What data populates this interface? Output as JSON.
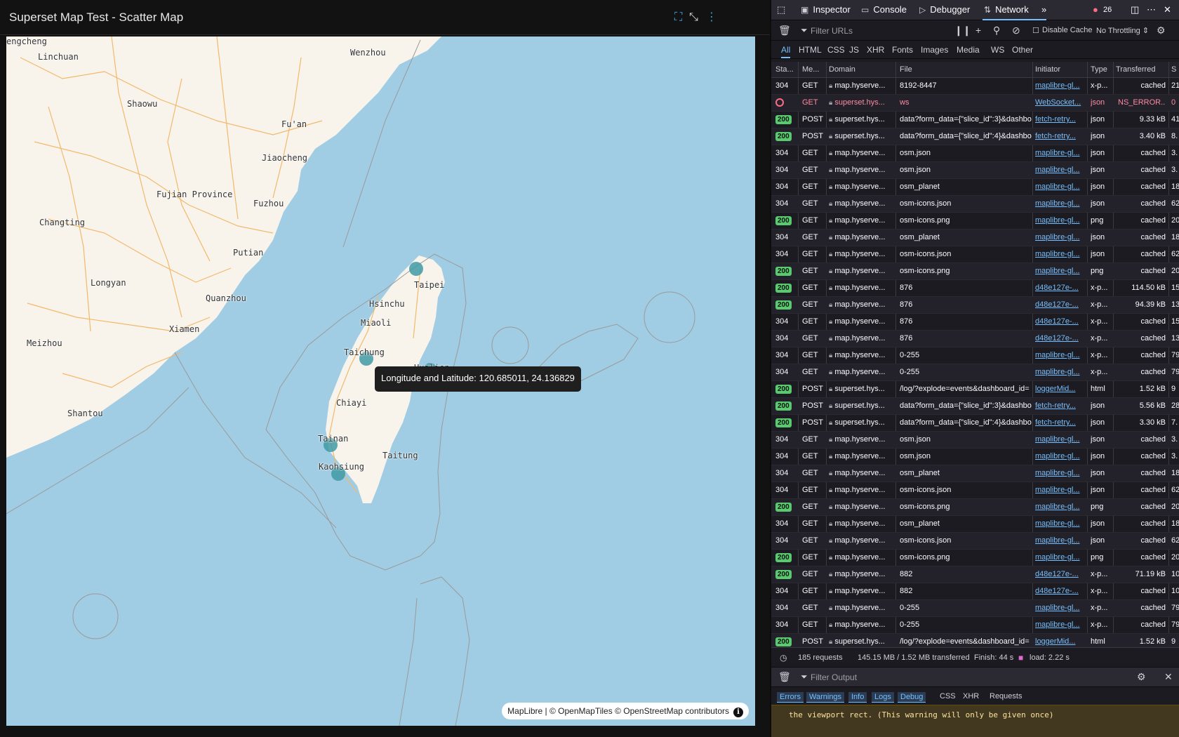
{
  "chart": {
    "title": "Superset Map Test - Scatter Map",
    "tooltip": "Longitude and Latitude: 120.685011, 24.136829",
    "attribution": "MapLibre | © OpenMapTiles © OpenStreetMap contributors",
    "info_glyph": "i",
    "cities": [
      "engcheng",
      "Linchuan",
      "Wenzhou",
      "Shaowu",
      "Fu'an",
      "Jiaocheng",
      "Fujian Province",
      "Fuzhou",
      "Changting",
      "Putian",
      "Longyan",
      "Quanzhou",
      "Xiamen",
      "Meizhou",
      "Shantou",
      "Taipei",
      "Hsinchu",
      "Miaoli",
      "Taichung",
      "Chiayi",
      "Tainan",
      "Kaohsiung",
      "Taitung",
      "Hualien"
    ]
  },
  "devtools": {
    "tabs": [
      "Inspector",
      "Console",
      "Debugger",
      "Network"
    ],
    "selected_tab": "Network",
    "error_count": "26",
    "filter_urls_placeholder": "Filter URLs",
    "disable_cache_label": "Disable Cache",
    "throttling": "No Throttling",
    "type_tabs": [
      "All",
      "HTML",
      "CSS",
      "JS",
      "XHR",
      "Fonts",
      "Images",
      "Media",
      "WS",
      "Other"
    ],
    "columns": [
      "Sta...",
      "Me...",
      "Domain",
      "File",
      "Initiator",
      "Type",
      "Transferred",
      "S"
    ],
    "rows": [
      {
        "status": "304",
        "method": "GET",
        "domain": "map.hyserve...",
        "file": "8192-8447",
        "initiator": "maplibre-gl...",
        "type": "x-p...",
        "transferred": "cached",
        "size": "21"
      },
      {
        "status": "error",
        "method": "GET",
        "domain": "superset.hys...",
        "file": "ws",
        "initiator": "WebSocket...",
        "type": "json",
        "transferred": "NS_ERROR...",
        "size": "0"
      },
      {
        "status": "200",
        "method": "POST",
        "domain": "superset.hys...",
        "file": "data?form_data={\"slice_id\":3}&dashbo",
        "initiator": "fetch-retry...",
        "type": "json",
        "transferred": "9.33 kB",
        "size": "41"
      },
      {
        "status": "200",
        "method": "POST",
        "domain": "superset.hys...",
        "file": "data?form_data={\"slice_id\":4}&dashbo",
        "initiator": "fetch-retry...",
        "type": "json",
        "transferred": "3.40 kB",
        "size": "8."
      },
      {
        "status": "304",
        "method": "GET",
        "domain": "map.hyserve...",
        "file": "osm.json",
        "initiator": "maplibre-gl...",
        "type": "json",
        "transferred": "cached",
        "size": "3."
      },
      {
        "status": "304",
        "method": "GET",
        "domain": "map.hyserve...",
        "file": "osm.json",
        "initiator": "maplibre-gl...",
        "type": "json",
        "transferred": "cached",
        "size": "3."
      },
      {
        "status": "304",
        "method": "GET",
        "domain": "map.hyserve...",
        "file": "osm_planet",
        "initiator": "maplibre-gl...",
        "type": "json",
        "transferred": "cached",
        "size": "18"
      },
      {
        "status": "304",
        "method": "GET",
        "domain": "map.hyserve...",
        "file": "osm-icons.json",
        "initiator": "maplibre-gl...",
        "type": "json",
        "transferred": "cached",
        "size": "62"
      },
      {
        "status": "200",
        "method": "GET",
        "domain": "map.hyserve...",
        "file": "osm-icons.png",
        "initiator": "maplibre-gl...",
        "type": "png",
        "transferred": "cached",
        "size": "20"
      },
      {
        "status": "304",
        "method": "GET",
        "domain": "map.hyserve...",
        "file": "osm_planet",
        "initiator": "maplibre-gl...",
        "type": "json",
        "transferred": "cached",
        "size": "18"
      },
      {
        "status": "304",
        "method": "GET",
        "domain": "map.hyserve...",
        "file": "osm-icons.json",
        "initiator": "maplibre-gl...",
        "type": "json",
        "transferred": "cached",
        "size": "62"
      },
      {
        "status": "200",
        "method": "GET",
        "domain": "map.hyserve...",
        "file": "osm-icons.png",
        "initiator": "maplibre-gl...",
        "type": "png",
        "transferred": "cached",
        "size": "20"
      },
      {
        "status": "200",
        "method": "GET",
        "domain": "map.hyserve...",
        "file": "876",
        "initiator": "d48e127e-...",
        "type": "x-p...",
        "transferred": "114.50 kB",
        "size": "15"
      },
      {
        "status": "200",
        "method": "GET",
        "domain": "map.hyserve...",
        "file": "876",
        "initiator": "d48e127e-...",
        "type": "x-p...",
        "transferred": "94.39 kB",
        "size": "13"
      },
      {
        "status": "304",
        "method": "GET",
        "domain": "map.hyserve...",
        "file": "876",
        "initiator": "d48e127e-...",
        "type": "x-p...",
        "transferred": "cached",
        "size": "15"
      },
      {
        "status": "304",
        "method": "GET",
        "domain": "map.hyserve...",
        "file": "876",
        "initiator": "d48e127e-...",
        "type": "x-p...",
        "transferred": "cached",
        "size": "13"
      },
      {
        "status": "304",
        "method": "GET",
        "domain": "map.hyserve...",
        "file": "0-255",
        "initiator": "maplibre-gl...",
        "type": "x-p...",
        "transferred": "cached",
        "size": "79"
      },
      {
        "status": "304",
        "method": "GET",
        "domain": "map.hyserve...",
        "file": "0-255",
        "initiator": "maplibre-gl...",
        "type": "x-p...",
        "transferred": "cached",
        "size": "79"
      },
      {
        "status": "200",
        "method": "POST",
        "domain": "superset.hys...",
        "file": "/log/?explode=events&dashboard_id=",
        "initiator": "loggerMid...",
        "type": "html",
        "transferred": "1.52 kB",
        "size": "9"
      },
      {
        "status": "200",
        "method": "POST",
        "domain": "superset.hys...",
        "file": "data?form_data={\"slice_id\":3}&dashbo",
        "initiator": "fetch-retry...",
        "type": "json",
        "transferred": "5.56 kB",
        "size": "28"
      },
      {
        "status": "200",
        "method": "POST",
        "domain": "superset.hys...",
        "file": "data?form_data={\"slice_id\":4}&dashbo",
        "initiator": "fetch-retry...",
        "type": "json",
        "transferred": "3.30 kB",
        "size": "7."
      },
      {
        "status": "304",
        "method": "GET",
        "domain": "map.hyserve...",
        "file": "osm.json",
        "initiator": "maplibre-gl...",
        "type": "json",
        "transferred": "cached",
        "size": "3."
      },
      {
        "status": "304",
        "method": "GET",
        "domain": "map.hyserve...",
        "file": "osm.json",
        "initiator": "maplibre-gl...",
        "type": "json",
        "transferred": "cached",
        "size": "3."
      },
      {
        "status": "304",
        "method": "GET",
        "domain": "map.hyserve...",
        "file": "osm_planet",
        "initiator": "maplibre-gl...",
        "type": "json",
        "transferred": "cached",
        "size": "18"
      },
      {
        "status": "304",
        "method": "GET",
        "domain": "map.hyserve...",
        "file": "osm-icons.json",
        "initiator": "maplibre-gl...",
        "type": "json",
        "transferred": "cached",
        "size": "62"
      },
      {
        "status": "200",
        "method": "GET",
        "domain": "map.hyserve...",
        "file": "osm-icons.png",
        "initiator": "maplibre-gl...",
        "type": "png",
        "transferred": "cached",
        "size": "20"
      },
      {
        "status": "304",
        "method": "GET",
        "domain": "map.hyserve...",
        "file": "osm_planet",
        "initiator": "maplibre-gl...",
        "type": "json",
        "transferred": "cached",
        "size": "18"
      },
      {
        "status": "304",
        "method": "GET",
        "domain": "map.hyserve...",
        "file": "osm-icons.json",
        "initiator": "maplibre-gl...",
        "type": "json",
        "transferred": "cached",
        "size": "62"
      },
      {
        "status": "200",
        "method": "GET",
        "domain": "map.hyserve...",
        "file": "osm-icons.png",
        "initiator": "maplibre-gl...",
        "type": "png",
        "transferred": "cached",
        "size": "20"
      },
      {
        "status": "200",
        "method": "GET",
        "domain": "map.hyserve...",
        "file": "882",
        "initiator": "d48e127e-...",
        "type": "x-p...",
        "transferred": "71.19 kB",
        "size": "10"
      },
      {
        "status": "304",
        "method": "GET",
        "domain": "map.hyserve...",
        "file": "882",
        "initiator": "d48e127e-...",
        "type": "x-p...",
        "transferred": "cached",
        "size": "10"
      },
      {
        "status": "304",
        "method": "GET",
        "domain": "map.hyserve...",
        "file": "0-255",
        "initiator": "maplibre-gl...",
        "type": "x-p...",
        "transferred": "cached",
        "size": "79"
      },
      {
        "status": "304",
        "method": "GET",
        "domain": "map.hyserve...",
        "file": "0-255",
        "initiator": "maplibre-gl...",
        "type": "x-p...",
        "transferred": "cached",
        "size": "79"
      },
      {
        "status": "200",
        "method": "POST",
        "domain": "superset.hys...",
        "file": "/log/?explode=events&dashboard_id=",
        "initiator": "loggerMid...",
        "type": "html",
        "transferred": "1.52 kB",
        "size": "9"
      }
    ],
    "summary": {
      "requests": "185 requests",
      "transferred": "145.15 MB / 1.52 MB transferred",
      "finish": "Finish: 44 s",
      "load": "load: 2.22 s"
    },
    "filter_output_placeholder": "Filter Output",
    "console_filters": [
      "Errors",
      "Warnings",
      "Info",
      "Logs",
      "Debug",
      "CSS",
      "XHR",
      "Requests"
    ],
    "console_message": "the viewport rect. (This warning will only be given once)"
  },
  "colors": {
    "accent": "#75bfff",
    "ok_badge": "#57cc6e",
    "error": "#ff6d85",
    "map_water": "#a0cde3",
    "map_land": "#f8f4ec",
    "point": "#3f9aa6"
  }
}
